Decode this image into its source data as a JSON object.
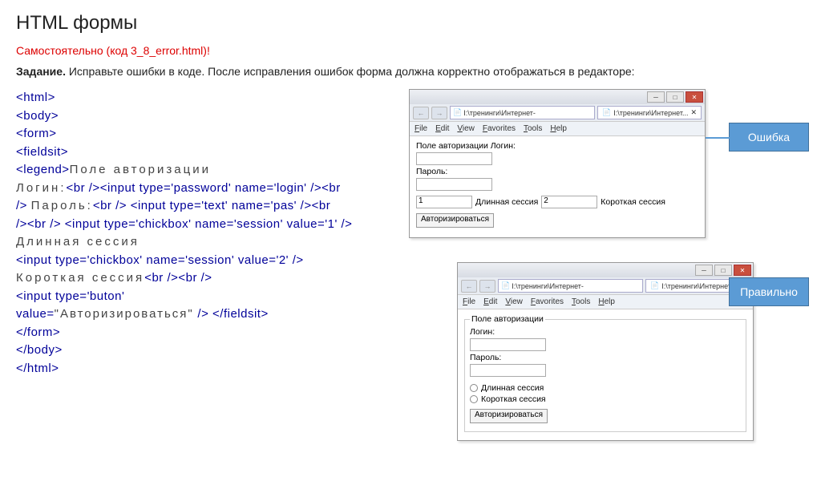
{
  "title": "HTML формы",
  "subtitle": "Самостоятельно (код 3_8_error.html)!",
  "task_bold": "Задание.",
  "task_text": " Исправьте ошибки в коде. После исправления ошибок форма должна корректно отображаться в редакторе:",
  "code": {
    "l1": "<html>",
    "l2": "<body>",
    "l3": "<form>",
    "l4": "<fieldsit>",
    "l5a": "<legend>",
    "l5t": "Поле авторизации",
    "l6t": "Логин:",
    "l6a": "<br /><input type='password' name='login' /><br",
    "l7a": "/> ",
    "l7t": "Пароль:",
    "l7b": "<br /> <input type='text' name='pas' /><br",
    "l8a": "/><br /> <input type='chickbox' name='session' value='1' />",
    "l9t": "Длинная сессия",
    "l10a": "<input type='chickbox' name='session' value='2' />",
    "l11t": "Короткая сессия",
    "l11a": "<br /><br />",
    "l12a": "<input type='buton'",
    "l13a": "value=",
    "l13t": "\"Авторизироваться\"",
    "l13b": " /> </fieldsit>",
    "l14": "</form>",
    "l15": "</body>",
    "l16": "</html>"
  },
  "browser": {
    "address": "I:\\тренинги\\Интернет-",
    "tab": "I:\\тренинги\\Интернет...",
    "menu": [
      "File",
      "Edit",
      "View",
      "Favorites",
      "Tools",
      "Help"
    ]
  },
  "page_error": {
    "line1": "Поле авторизации Логин:",
    "line2": "Пароль:",
    "val1": "1",
    "long": "Длинная сессия",
    "val2": "2",
    "short": "Короткая сессия",
    "btn": "Авторизироваться"
  },
  "page_ok": {
    "legend": "Поле авторизации",
    "login": "Логин:",
    "pass": "Пароль:",
    "long": "Длинная сессия",
    "short": "Короткая сессия",
    "btn": "Авторизироваться"
  },
  "callout_err": "Ошибка",
  "callout_ok": "Правильно"
}
